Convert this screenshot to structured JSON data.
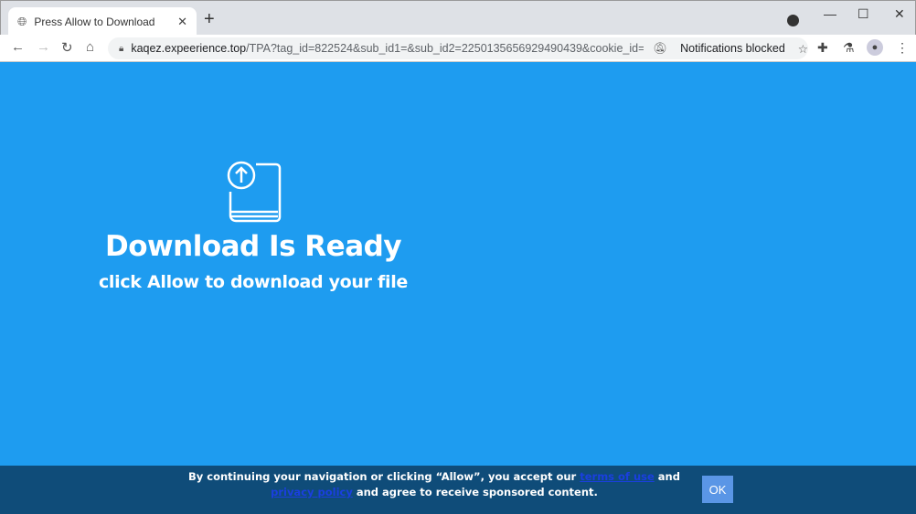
{
  "browser": {
    "tab_title": "Press Allow to Download",
    "tab_close": "✕",
    "new_tab": "+",
    "url_host": "kaqez.expeerience.top",
    "url_path": "/TPA?tag_id=822524&sub_id1=&sub_id2=2250135656929490439&cookie_id=f68...",
    "notifications": "Notifications blocked"
  },
  "hero": {
    "icon": "book-upload-icon",
    "title": "Download Is Ready",
    "subtitle": "click Allow to download your file"
  },
  "footer": {
    "text1": "By continuing your navigation or clicking “Allow”, you accept our ",
    "terms": "terms of use",
    "and": " and ",
    "privacy": "privacy policy",
    "text2": " and agree to receive sponsored content.",
    "ok": "OK"
  },
  "colors": {
    "background": "#1e9cf0",
    "footer": "#0f4c79",
    "ok_button": "#5a96e6"
  }
}
